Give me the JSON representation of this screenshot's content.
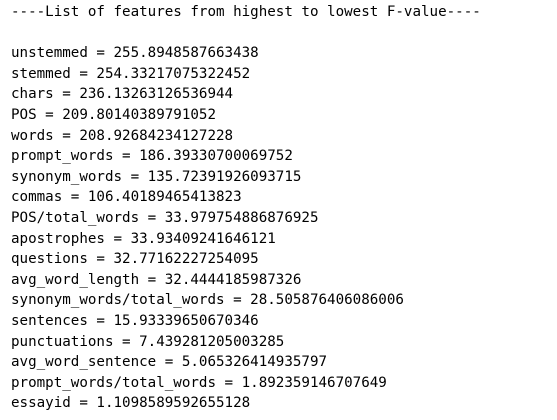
{
  "header": "----List of features from highest to lowest F-value----",
  "features": [
    "unstemmed = 255.8948587663438",
    "stemmed = 254.33217075322452",
    "chars = 236.13263126536944",
    "POS = 209.80140389791052",
    "words = 208.92684234127228",
    "prompt_words = 186.39330700069752",
    "synonym_words = 135.72391926093715",
    "commas = 106.40189465413823",
    "POS/total_words = 33.979754886876925",
    "apostrophes = 33.93409241646121",
    "questions = 32.77162227254095",
    "avg_word_length = 32.4444185987326",
    "synonym_words/total_words = 28.505876406086006",
    "sentences = 15.93339650670346",
    "punctuations = 7.439281205003285",
    "avg_word_sentence = 5.065326414935797",
    "prompt_words/total_words = 1.892359146707649",
    "essayid = 1.1098589592655128"
  ]
}
